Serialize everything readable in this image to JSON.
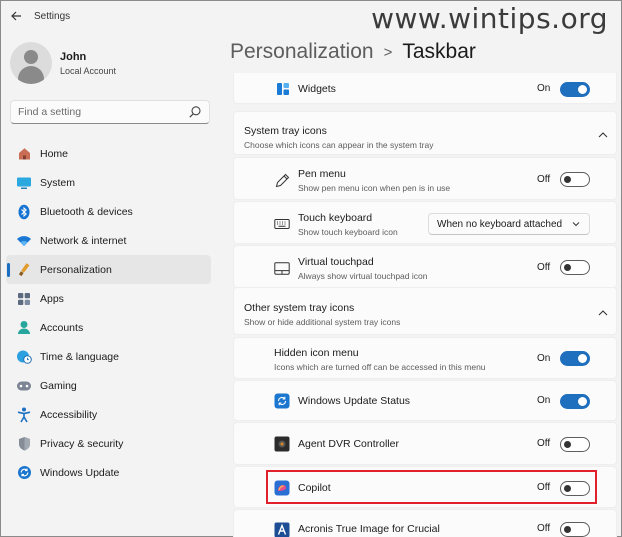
{
  "window": {
    "title": "Settings",
    "watermark": "www.wintips.org"
  },
  "user": {
    "name": "John",
    "account": "Local Account"
  },
  "search": {
    "placeholder": "Find a setting"
  },
  "nav": [
    {
      "label": "Home",
      "icon": "home-icon"
    },
    {
      "label": "System",
      "icon": "monitor-icon"
    },
    {
      "label": "Bluetooth & devices",
      "icon": "bluetooth-icon"
    },
    {
      "label": "Network & internet",
      "icon": "wifi-icon"
    },
    {
      "label": "Personalization",
      "icon": "brush-icon",
      "active": true
    },
    {
      "label": "Apps",
      "icon": "apps-icon"
    },
    {
      "label": "Accounts",
      "icon": "person-icon"
    },
    {
      "label": "Time & language",
      "icon": "globe-clock-icon"
    },
    {
      "label": "Gaming",
      "icon": "gamepad-icon"
    },
    {
      "label": "Accessibility",
      "icon": "accessibility-icon"
    },
    {
      "label": "Privacy & security",
      "icon": "shield-icon"
    },
    {
      "label": "Windows Update",
      "icon": "update-icon"
    }
  ],
  "breadcrumb": {
    "parent": "Personalization",
    "separator": ">",
    "current": "Taskbar"
  },
  "widgets": {
    "label": "Widgets",
    "state": "On"
  },
  "system_tray": {
    "title": "System tray icons",
    "subtitle": "Choose which icons can appear in the system tray",
    "items": [
      {
        "label": "Pen menu",
        "desc": "Show pen menu icon when pen is in use",
        "state": "Off"
      },
      {
        "label": "Touch keyboard",
        "desc": "Show touch keyboard icon",
        "dropdown": "When no keyboard attached"
      },
      {
        "label": "Virtual touchpad",
        "desc": "Always show virtual touchpad icon",
        "state": "Off"
      }
    ]
  },
  "other_tray": {
    "title": "Other system tray icons",
    "subtitle": "Show or hide additional system tray icons",
    "items": [
      {
        "label": "Hidden icon menu",
        "desc": "Icons which are turned off can be accessed in this menu",
        "state": "On"
      },
      {
        "label": "Windows Update Status",
        "state": "On"
      },
      {
        "label": "Agent DVR Controller",
        "state": "Off"
      },
      {
        "label": "Copilot",
        "state": "Off"
      },
      {
        "label": "Acronis True Image for Crucial",
        "state": "Off"
      }
    ]
  },
  "colors": {
    "accent": "#1f6fbf",
    "highlight": "#e0202a"
  }
}
